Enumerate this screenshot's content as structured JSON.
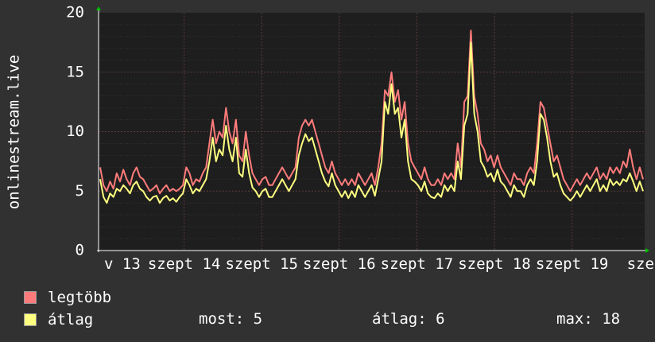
{
  "chart_data": {
    "type": "line",
    "ylabel": "onlinestream.live",
    "xlabel": "",
    "ylim": [
      0,
      20
    ],
    "y_ticks": [
      "0",
      "5",
      "10",
      "15",
      "20"
    ],
    "x_ticks": [
      "v 13",
      "szept 14",
      "szept 15",
      "szept 16",
      "szept 17",
      "szept 18",
      "szept 19",
      "szept"
    ],
    "grid": true,
    "background": "#1e1e1e",
    "series": [
      {
        "name": "legtöbb",
        "color": "#ff7b7b",
        "values": [
          7,
          5.5,
          5,
          5.8,
          5.2,
          6.5,
          5.8,
          6.8,
          6,
          5.5,
          6.5,
          7,
          6.2,
          6,
          5.5,
          5,
          5.2,
          5.5,
          4.8,
          5.2,
          5.5,
          5,
          5.2,
          5,
          5.2,
          5.5,
          7,
          6.5,
          5.5,
          6,
          5.8,
          6.5,
          7,
          9,
          11,
          9,
          10,
          9.5,
          12,
          10,
          9,
          11,
          8,
          7.5,
          10,
          8,
          6.5,
          6,
          5.5,
          6,
          6.2,
          5.5,
          5.5,
          6,
          6.5,
          7,
          6.5,
          6,
          6.5,
          7,
          9.5,
          10.5,
          11,
          10.5,
          11,
          10,
          9,
          8,
          7,
          6.5,
          7.5,
          6.5,
          6,
          5.5,
          6,
          5.5,
          6,
          5.5,
          6.5,
          6,
          5.5,
          6,
          6.5,
          5.5,
          7,
          9,
          13.5,
          13,
          15,
          12.5,
          13.5,
          11,
          12.5,
          9,
          7.5,
          7,
          6.5,
          6,
          7,
          6,
          5.5,
          5.5,
          6,
          5.5,
          6.5,
          6,
          6.5,
          6,
          9,
          7,
          12.5,
          13,
          18.5,
          13,
          11.5,
          9,
          8.5,
          7.5,
          8,
          7,
          8,
          7,
          6.5,
          6,
          5.5,
          6.5,
          6,
          6,
          5.5,
          6.5,
          7,
          6.5,
          9,
          12.5,
          12,
          10.5,
          9,
          7.5,
          8,
          7,
          6,
          5.5,
          5,
          5.5,
          6,
          5.5,
          6,
          6.5,
          6,
          6.5,
          7,
          6,
          6.5,
          6,
          7,
          6.5,
          7,
          6.5,
          7.5,
          7,
          8.5,
          7,
          6,
          7,
          6
        ]
      },
      {
        "name": "átlag",
        "color": "#ffff80",
        "values": [
          6,
          4.5,
          4,
          4.8,
          4.5,
          5.2,
          5,
          5.5,
          5.2,
          4.8,
          5.5,
          5.8,
          5.2,
          5,
          4.5,
          4.2,
          4.5,
          4.6,
          4,
          4.4,
          4.6,
          4.2,
          4.4,
          4.1,
          4.5,
          4.8,
          6,
          5.5,
          4.8,
          5.2,
          5,
          5.5,
          6,
          7.5,
          9.5,
          7.5,
          8.5,
          8,
          10.5,
          8.5,
          7.5,
          9.5,
          6.5,
          6.2,
          8.5,
          6.5,
          5.3,
          5,
          4.5,
          5,
          5.2,
          4.5,
          4.5,
          5,
          5.5,
          6,
          5.5,
          5,
          5.5,
          6,
          8,
          9,
          9.8,
          9.2,
          9.5,
          8.5,
          7.5,
          6.5,
          5.8,
          5.4,
          6.5,
          5.5,
          5,
          4.5,
          5,
          4.4,
          5,
          4.5,
          5.5,
          5,
          4.5,
          5,
          5.5,
          4.6,
          6,
          7.5,
          12.5,
          11.5,
          14,
          11.5,
          12,
          9.5,
          11,
          7.5,
          6,
          5.8,
          5.5,
          5,
          5.8,
          4.8,
          4.5,
          4.4,
          4.8,
          4.5,
          5.5,
          5,
          5.5,
          5,
          7.5,
          6,
          10.5,
          11.5,
          17.5,
          11.5,
          10,
          7.5,
          7,
          6.2,
          6.5,
          5.8,
          6.8,
          5.8,
          5.5,
          5,
          4.5,
          5.5,
          5,
          5,
          4.5,
          5.5,
          6,
          5.5,
          7.5,
          11.5,
          11,
          9.5,
          7.5,
          6.2,
          6.5,
          5.5,
          4.8,
          4.5,
          4.2,
          4.5,
          5,
          4.5,
          5,
          5.5,
          5,
          5.5,
          6,
          5,
          5.5,
          5,
          6,
          5.5,
          5.8,
          5.5,
          6,
          5.8,
          6.5,
          5.8,
          5,
          5.8,
          5
        ]
      }
    ]
  },
  "legend": [
    {
      "label": "legtöbb",
      "color": "#ff7b7b"
    },
    {
      "label": "átlag",
      "color": "#ffff80"
    }
  ],
  "stats": {
    "now": "most: 5",
    "avg": "átlag: 6",
    "max": "max: 18"
  }
}
